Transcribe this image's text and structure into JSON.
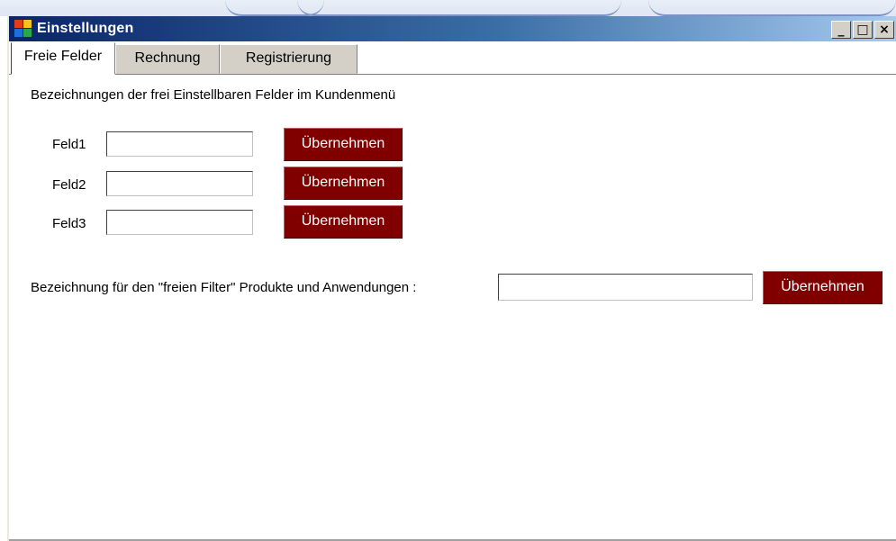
{
  "window": {
    "title": "Einstellungen",
    "controls": {
      "minimize": "_",
      "maximize": "□",
      "close": "×"
    }
  },
  "tabs": [
    {
      "label": "Freie Felder",
      "active": true
    },
    {
      "label": "Rechnung",
      "active": false
    },
    {
      "label": "Registrierung",
      "active": false
    }
  ],
  "panel": {
    "heading": "Bezeichnungen der frei Einstellbaren Felder im Kundenmenü",
    "fields": [
      {
        "label": "Feld1",
        "value": "",
        "button": "Übernehmen"
      },
      {
        "label": "Feld2",
        "value": "",
        "button": "Übernehmen"
      },
      {
        "label": "Feld3",
        "value": "",
        "button": "Übernehmen"
      }
    ],
    "filter": {
      "label": "Bezeichnung für den \"freien Filter\" Produkte und Anwendungen :",
      "value": "",
      "button": "Übernehmen"
    }
  },
  "colors": {
    "button_bg": "#800000",
    "titlebar_start": "#0a246a",
    "titlebar_end": "#a6caf0"
  },
  "icons": {
    "app": "window-app-icon"
  }
}
